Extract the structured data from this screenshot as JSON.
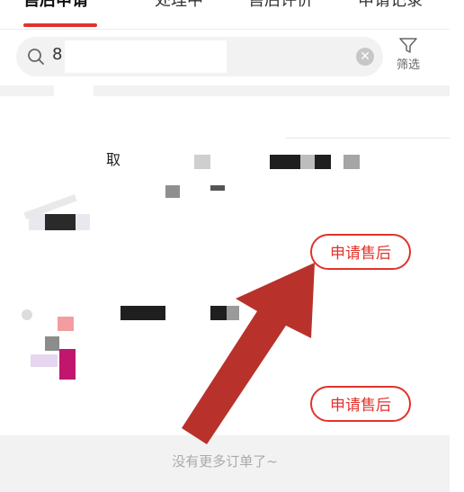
{
  "tabs": {
    "items": [
      {
        "label": "售后申请"
      },
      {
        "label": "处理中"
      },
      {
        "label": "售后评价"
      },
      {
        "label": "申请记录"
      }
    ]
  },
  "search": {
    "value": "8",
    "filter_label": "筛选"
  },
  "orders": [
    {
      "title": "取",
      "action_label": "申请售后"
    },
    {
      "title": "",
      "action_label": "申请售后"
    }
  ],
  "footer": {
    "text": "没有更多订单了~"
  },
  "colors": {
    "accent": "#e0332b",
    "annotation_arrow": "#b8322b"
  }
}
